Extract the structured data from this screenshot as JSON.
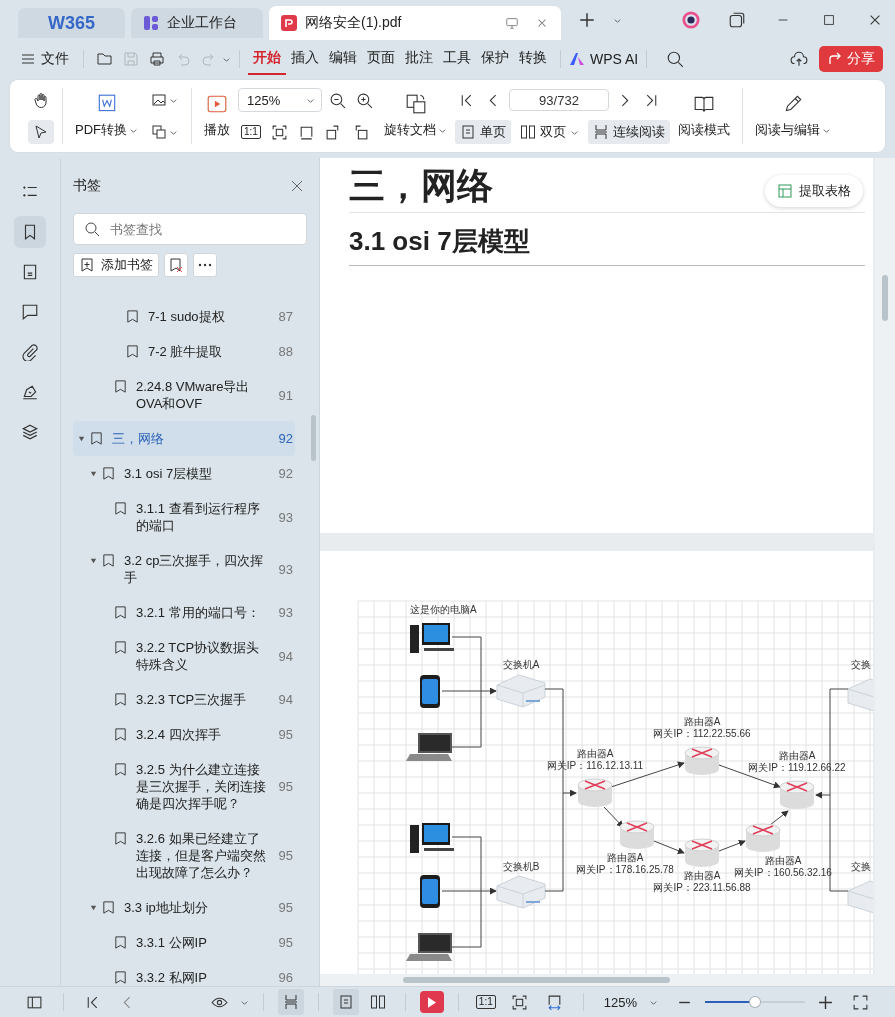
{
  "tabs": [
    {
      "kind": "logo",
      "label": "W365",
      "selected": false
    },
    {
      "kind": "app",
      "label": "企业工作台",
      "selected": false
    },
    {
      "kind": "pdf",
      "label": "网络安全(1).pdf",
      "selected": true
    }
  ],
  "file_menu": "文件",
  "quick_access": [
    {
      "kind": "open",
      "disabled": false
    },
    {
      "kind": "save",
      "disabled": true
    },
    {
      "kind": "print",
      "disabled": false
    },
    {
      "kind": "undo",
      "disabled": true
    },
    {
      "kind": "redo",
      "disabled": true
    }
  ],
  "menu_tabs": [
    {
      "label": "开始",
      "selected": true
    },
    {
      "label": "插入",
      "selected": false
    },
    {
      "label": "编辑",
      "selected": false
    },
    {
      "label": "页面",
      "selected": false
    },
    {
      "label": "批注",
      "selected": false
    },
    {
      "label": "工具",
      "selected": false
    },
    {
      "label": "保护",
      "selected": false
    },
    {
      "label": "转换",
      "selected": false
    }
  ],
  "ai_label": "WPS AI",
  "share_button": "分享",
  "toolbar": {
    "tools": [
      {
        "kind": "hand",
        "selected": false
      },
      {
        "kind": "select",
        "selected": true
      }
    ],
    "pdf_convert": "PDF转换",
    "play": "播放",
    "zoom": "125%",
    "actual_size": "1:1",
    "rotate": "旋转文档",
    "page": "93/732",
    "view_modes": [
      {
        "kind": "single",
        "label": "单页",
        "selected": true
      },
      {
        "kind": "double",
        "label": "双页",
        "selected": false
      },
      {
        "kind": "continuous",
        "label": "连续阅读",
        "selected": true
      }
    ],
    "read_mode": "阅读模式",
    "read_edit": "阅读与编辑"
  },
  "rail": [
    {
      "kind": "outline",
      "selected": false
    },
    {
      "kind": "bookmark",
      "selected": true
    },
    {
      "kind": "page",
      "selected": false
    },
    {
      "kind": "comment",
      "selected": false
    },
    {
      "kind": "attachment",
      "selected": false
    },
    {
      "kind": "sign",
      "selected": false
    },
    {
      "kind": "layers",
      "selected": false
    }
  ],
  "bookmarks_panel": {
    "title": "书签",
    "search_placeholder": "书签查找",
    "add_button": "添加书签",
    "items": [
      {
        "children": [
          {
            "children": [
              {
                "children": [
                  {
                    "label": "7-1 sudo提权",
                    "page": "87",
                    "selected": false
                  },
                  {
                    "label": "7-2 脏牛提取",
                    "page": "88",
                    "selected": false
                  }
                ]
              },
              {
                "label": "2.24.8 VMware导出OVA和OVF",
                "page": "91",
                "selected": false
              }
            ]
          }
        ]
      },
      {
        "label": "三，网络",
        "page": "92",
        "selected": true,
        "expanded": true,
        "children": [
          {
            "label": "3.1 osi 7层模型",
            "page": "92",
            "selected": false,
            "expanded": true,
            "children": [
              {
                "label": "3.1.1  查看到运行程序的端口",
                "page": "93",
                "selected": false
              }
            ]
          },
          {
            "label": "3.2  cp三次握手，四次挥手",
            "page": "93",
            "selected": false,
            "expanded": true,
            "children": [
              {
                "label": "3.2.1 常用的端口号：",
                "page": "93",
                "selected": false
              },
              {
                "label": "3.2.2 TCP协议数据头特殊含义",
                "page": "94",
                "selected": false
              },
              {
                "label": "3.2.3 TCP三次握手",
                "page": "94",
                "selected": false
              },
              {
                "label": "3.2.4 四次挥手",
                "page": "95",
                "selected": false
              },
              {
                "label": "3.2.5 为什么建立连接是三次握手，关闭连接确是四次挥手呢？",
                "page": "95",
                "selected": false
              },
              {
                "label": "3.2.6 如果已经建立了连接，但是客户端突然出现故障了怎么办？",
                "page": "95",
                "selected": false
              }
            ]
          },
          {
            "label": "3.3 ip地址划分",
            "page": "95",
            "selected": false,
            "expanded": true,
            "children": [
              {
                "label": "3.3.1 公网IP",
                "page": "95",
                "selected": false
              },
              {
                "label": "3.3.2 私网IP",
                "page": "96",
                "selected": false
              }
            ]
          }
        ]
      }
    ]
  },
  "document": {
    "heading_1": "三，网络",
    "heading_2": "3.1 osi 7层模型",
    "extract_button": "提取表格",
    "diagram": {
      "caption": "这是你的电脑A",
      "switches": [
        {
          "label": "交换机A"
        },
        {
          "label": "交换机B"
        },
        {
          "label": "交换"
        },
        {
          "label": "交换"
        }
      ],
      "routers": [
        {
          "name": "路由器A",
          "gateway": "网关IP：112.22.55.66"
        },
        {
          "name": "路由器A",
          "gateway": "网关IP：116.12.13.11"
        },
        {
          "name": "路由器A",
          "gateway": "网关IP：119.12.66.22"
        },
        {
          "name": "路由器A",
          "gateway": "网关IP：178.16.25.78"
        },
        {
          "name": "路由器A",
          "gateway": "网关IP：160.56.32.16"
        },
        {
          "name": "路由器A",
          "gateway": "网关IP：223.11.56.88"
        }
      ]
    }
  },
  "status_bar": {
    "view_modes": [
      {
        "kind": "continuous",
        "selected": true
      },
      {
        "kind": "single",
        "selected": true
      },
      {
        "kind": "double",
        "selected": false
      }
    ],
    "actual_size": "1:1",
    "zoom": "125%",
    "zoom_slider": {
      "level": 0.5
    }
  }
}
